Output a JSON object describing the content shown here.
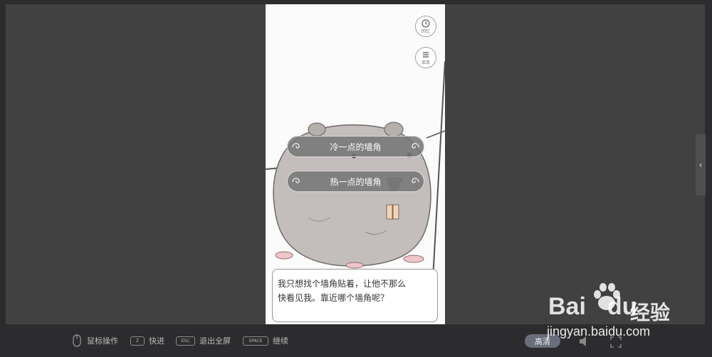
{
  "game": {
    "side_buttons": [
      {
        "label": "回忆",
        "icon": "memory-icon"
      },
      {
        "label": "菜单",
        "icon": "menu-icon"
      }
    ],
    "choices": [
      {
        "label": "冷一点的墙角"
      },
      {
        "label": "热一点的墙角"
      }
    ],
    "dialog": {
      "line1": "我只想找个墙角贴着，让他不那么",
      "line2": "快看见我。靠近哪个墙角呢？"
    }
  },
  "toolbar": {
    "mouse": {
      "label": "鼠标操作",
      "icon": "mouse-icon"
    },
    "fast": {
      "key": "Z",
      "label": "快进"
    },
    "exit": {
      "key": "ESC",
      "label": "退出全屏"
    },
    "continue": {
      "key": "SPACE",
      "label": "继续"
    },
    "quality": "高清",
    "volume_icon": "speaker-icon",
    "fullscreen_icon": "fullscreen-icon"
  },
  "side_panel": {
    "collapse_icon": "chevron-left-icon",
    "glyph": "‹"
  },
  "watermark": {
    "brand": "Bai",
    "brand2": "du",
    "cn": "经验",
    "url": "jingyan.baidu.com"
  },
  "colors": {
    "toolbar_bg": "#2c2c2e",
    "stage_bg": "#414141",
    "choice_bg": "#787878",
    "quality_pill": "#6a6e7a"
  }
}
